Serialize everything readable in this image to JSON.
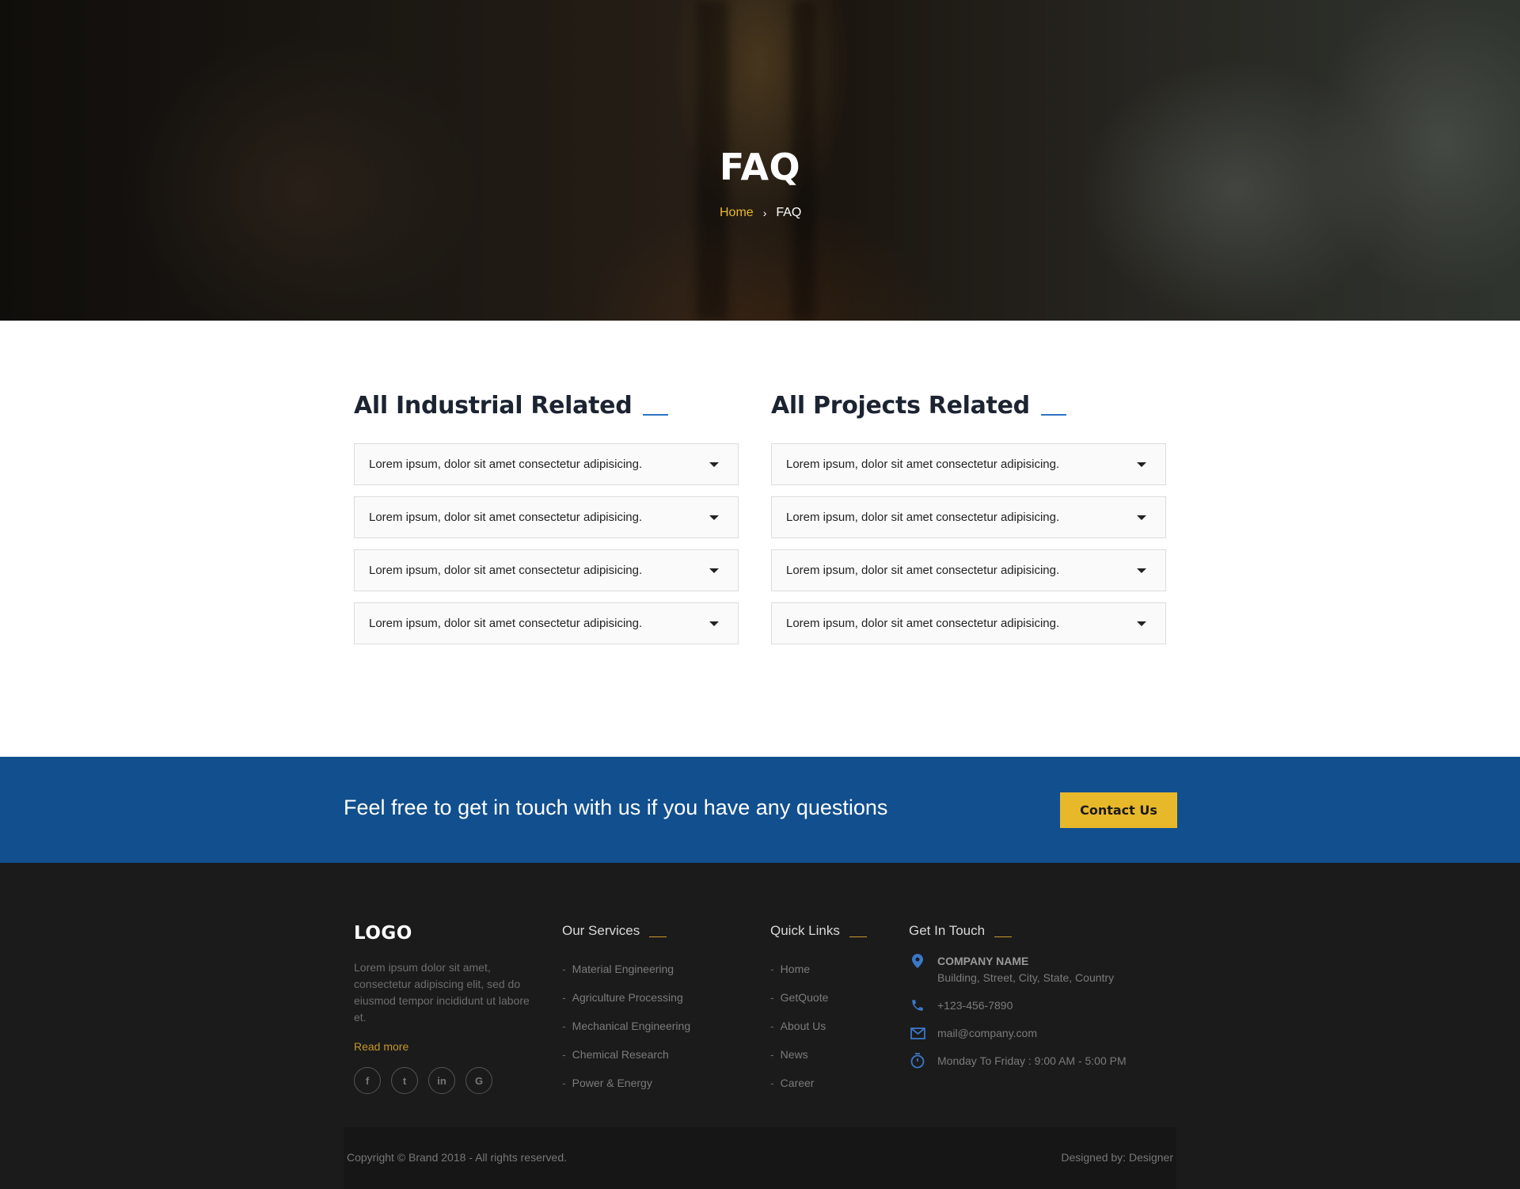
{
  "hero": {
    "title": "FAQ",
    "breadcrumb": {
      "home": "Home",
      "separator": "›",
      "current": "FAQ"
    }
  },
  "faq": {
    "columns": [
      {
        "heading": "All Industrial Related",
        "items": [
          "Lorem ipsum, dolor sit amet consectetur adipisicing.",
          "Lorem ipsum, dolor sit amet consectetur adipisicing.",
          "Lorem ipsum, dolor sit amet consectetur adipisicing.",
          "Lorem ipsum, dolor sit amet consectetur adipisicing."
        ]
      },
      {
        "heading": "All Projects Related",
        "items": [
          "Lorem ipsum, dolor sit amet consectetur adipisicing.",
          "Lorem ipsum, dolor sit amet consectetur adipisicing.",
          "Lorem ipsum, dolor sit amet consectetur adipisicing.",
          "Lorem ipsum, dolor sit amet consectetur adipisicing."
        ]
      }
    ],
    "item_icon": "caret-down-icon"
  },
  "cta": {
    "text": "Feel free to get in touch with us if you have any questions",
    "button": "Contact Us"
  },
  "footer": {
    "logo": "LOGO",
    "about": "Lorem ipsum dolor sit amet, consectetur adipiscing elit, sed do eiusmod tempor incididunt ut labore et.",
    "read_more": "Read more",
    "socials": [
      {
        "icon": "facebook-icon",
        "glyph": "f"
      },
      {
        "icon": "twitter-icon",
        "glyph": "t"
      },
      {
        "icon": "linkedin-icon",
        "glyph": "in"
      },
      {
        "icon": "google-icon",
        "glyph": "G"
      }
    ],
    "services": {
      "title": "Our Services",
      "items": [
        "Material Engineering",
        "Agriculture Processing",
        "Mechanical Engineering",
        "Chemical Research",
        "Power & Energy"
      ]
    },
    "quick_links": {
      "title": "Quick Links",
      "items": [
        "Home",
        "GetQuote",
        "About Us",
        "News",
        "Career"
      ]
    },
    "contact": {
      "title": "Get In Touch",
      "company": "COMPANY NAME",
      "address": "Building, Street, City, State, Country",
      "phone": "+123-456-7890",
      "email": "mail@company.com",
      "hours": "Monday To Friday : 9:00 AM - 5:00 PM"
    },
    "copyright": "Copyright © Brand 2018 - All rights reserved.",
    "designed_by": "Designed by: Designer",
    "colors": {
      "accent": "#e8b82b",
      "cta_bg": "#114f8e",
      "heading_line": "#2e72c8",
      "icon_blue": "#3a78c9"
    }
  }
}
